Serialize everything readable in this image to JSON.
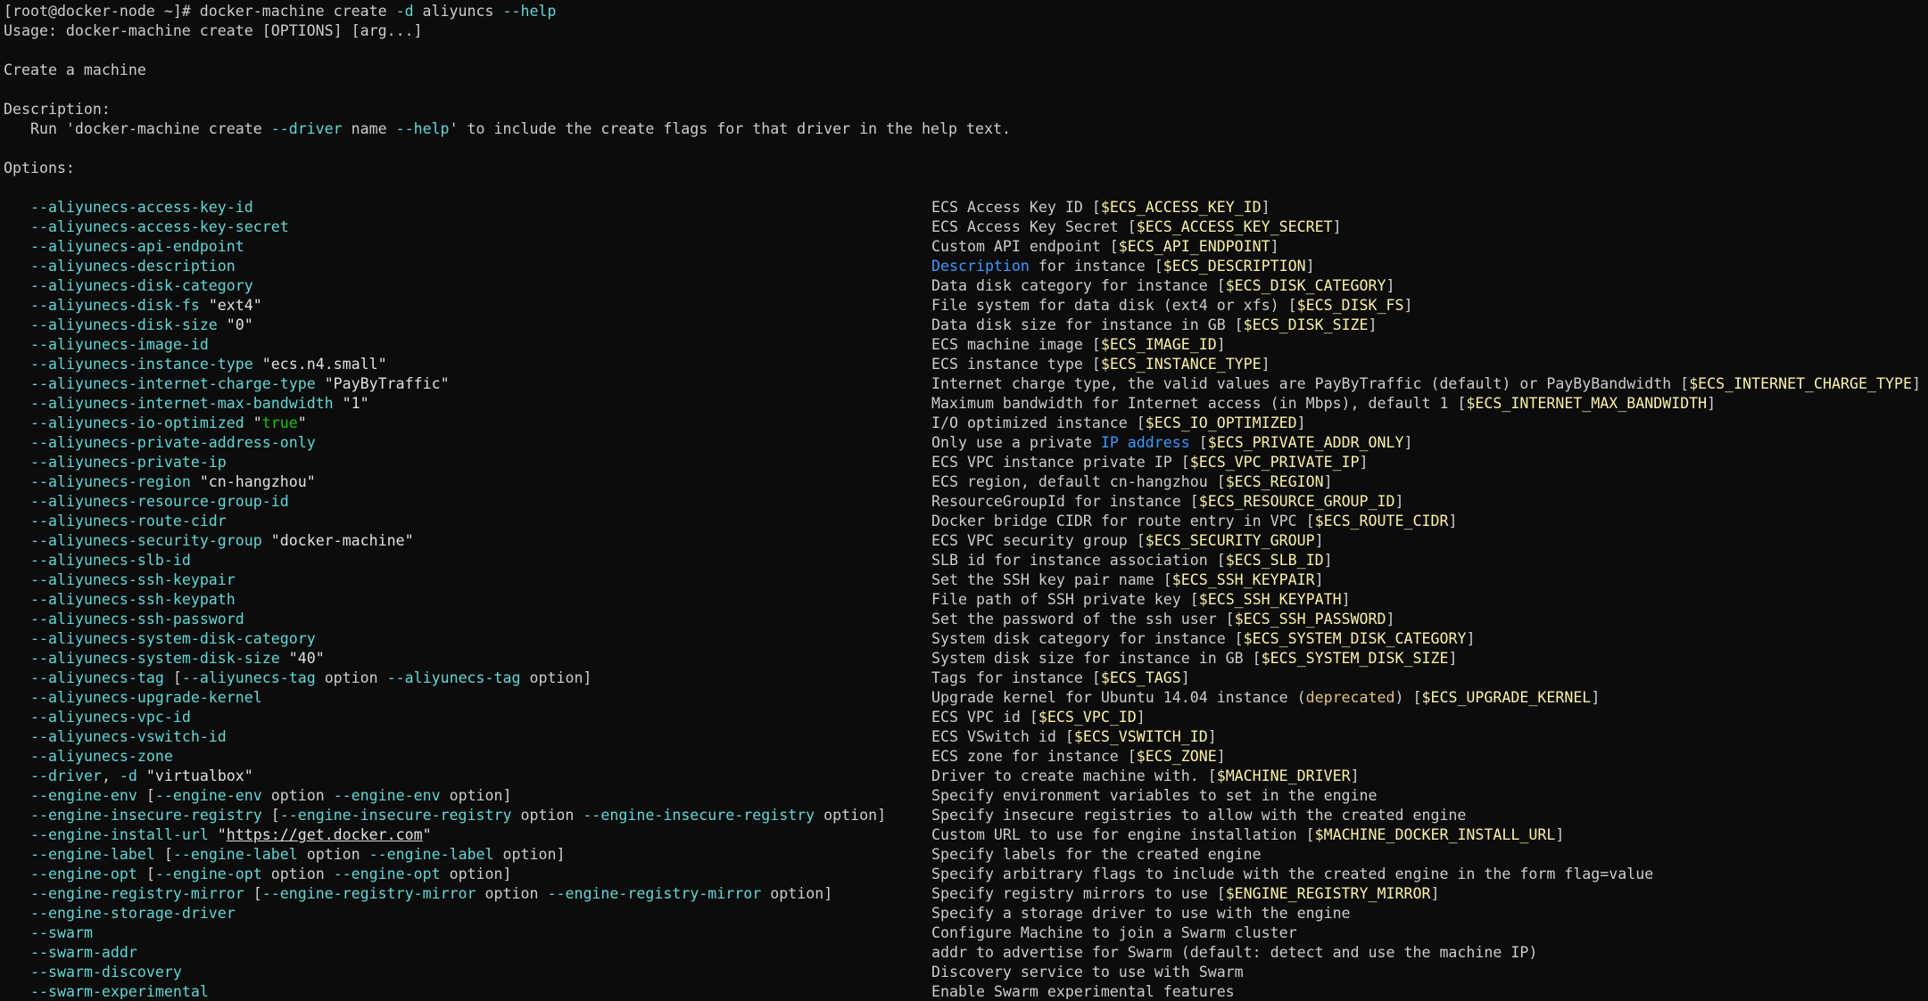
{
  "theme": {
    "background": "#0c0c0c",
    "foreground": "#cccccc",
    "flag": "#61d6d6",
    "string": "#e0e0e0",
    "env": "#f9f1a5",
    "link": "#3b9aff",
    "true": "#16c60c"
  },
  "header": [
    [
      {
        "t": "[root@docker-node ~]# docker-machine create ",
        "c": "plain"
      },
      {
        "t": "-d",
        "c": "flag"
      },
      {
        "t": " aliyuncs ",
        "c": "plain"
      },
      {
        "t": "--help",
        "c": "flag"
      }
    ],
    [
      {
        "t": "Usage: docker-machine create [OPTIONS] [arg...]",
        "c": "plain"
      }
    ],
    [],
    [
      {
        "t": "Create a machine",
        "c": "plain"
      }
    ],
    [],
    [
      {
        "t": "Description:",
        "c": "plain"
      }
    ],
    [
      {
        "t": "   Run 'docker-machine create ",
        "c": "plain"
      },
      {
        "t": "--driver",
        "c": "flag"
      },
      {
        "t": " name ",
        "c": "plain"
      },
      {
        "t": "--help",
        "c": "flag"
      },
      {
        "t": "' to include the create flags for that driver in the help text.",
        "c": "plain"
      }
    ],
    [],
    [
      {
        "t": "Options:",
        "c": "plain"
      }
    ],
    []
  ],
  "options": [
    {
      "left": [
        {
          "t": "--aliyunecs-access-key-id",
          "c": "flag"
        }
      ],
      "right": [
        {
          "t": "ECS Access Key ID [",
          "c": "plain"
        },
        {
          "t": "$ECS_ACCESS_KEY_ID",
          "c": "env"
        },
        {
          "t": "]",
          "c": "plain"
        }
      ]
    },
    {
      "left": [
        {
          "t": "--aliyunecs-access-key-secret",
          "c": "flag"
        }
      ],
      "right": [
        {
          "t": "ECS Access Key Secret [",
          "c": "plain"
        },
        {
          "t": "$ECS_ACCESS_KEY_SECRET",
          "c": "env"
        },
        {
          "t": "]",
          "c": "plain"
        }
      ]
    },
    {
      "left": [
        {
          "t": "--aliyunecs-api-endpoint",
          "c": "flag"
        }
      ],
      "right": [
        {
          "t": "Custom API endpoint [",
          "c": "plain"
        },
        {
          "t": "$ECS_API_ENDPOINT",
          "c": "env"
        },
        {
          "t": "]",
          "c": "plain"
        }
      ]
    },
    {
      "left": [
        {
          "t": "--aliyunecs-description",
          "c": "flag"
        }
      ],
      "right": [
        {
          "t": "Description",
          "c": "blue"
        },
        {
          "t": " for instance [",
          "c": "plain"
        },
        {
          "t": "$ECS_DESCRIPTION",
          "c": "env"
        },
        {
          "t": "]",
          "c": "plain"
        }
      ]
    },
    {
      "left": [
        {
          "t": "--aliyunecs-disk-category",
          "c": "flag"
        }
      ],
      "right": [
        {
          "t": "Data disk category for instance [",
          "c": "plain"
        },
        {
          "t": "$ECS_DISK_CATEGORY",
          "c": "env"
        },
        {
          "t": "]",
          "c": "plain"
        }
      ]
    },
    {
      "left": [
        {
          "t": "--aliyunecs-disk-fs",
          "c": "flag"
        },
        {
          "t": " \"ext4\"",
          "c": "string"
        }
      ],
      "right": [
        {
          "t": "File system for data disk (ext4 or xfs) [",
          "c": "plain"
        },
        {
          "t": "$ECS_DISK_FS",
          "c": "env"
        },
        {
          "t": "]",
          "c": "plain"
        }
      ]
    },
    {
      "left": [
        {
          "t": "--aliyunecs-disk-size",
          "c": "flag"
        },
        {
          "t": " \"0\"",
          "c": "string"
        }
      ],
      "right": [
        {
          "t": "Data disk size for instance in GB [",
          "c": "plain"
        },
        {
          "t": "$ECS_DISK_SIZE",
          "c": "env"
        },
        {
          "t": "]",
          "c": "plain"
        }
      ]
    },
    {
      "left": [
        {
          "t": "--aliyunecs-image-id",
          "c": "flag"
        }
      ],
      "right": [
        {
          "t": "ECS machine image [",
          "c": "plain"
        },
        {
          "t": "$ECS_IMAGE_ID",
          "c": "env"
        },
        {
          "t": "]",
          "c": "plain"
        }
      ]
    },
    {
      "left": [
        {
          "t": "--aliyunecs-instance-type",
          "c": "flag"
        },
        {
          "t": " \"ecs.n4.small\"",
          "c": "string"
        }
      ],
      "right": [
        {
          "t": "ECS instance type [",
          "c": "plain"
        },
        {
          "t": "$ECS_INSTANCE_TYPE",
          "c": "env"
        },
        {
          "t": "]",
          "c": "plain"
        }
      ]
    },
    {
      "left": [
        {
          "t": "--aliyunecs-internet-charge-type",
          "c": "flag"
        },
        {
          "t": " \"PayByTraffic\"",
          "c": "string"
        }
      ],
      "right": [
        {
          "t": "Internet charge type, the valid values are PayByTraffic (default) or PayByBandwidth [",
          "c": "plain"
        },
        {
          "t": "$ECS_INTERNET_CHARGE_TYPE",
          "c": "env"
        },
        {
          "t": "]",
          "c": "plain"
        }
      ]
    },
    {
      "left": [
        {
          "t": "--aliyunecs-internet-max-bandwidth",
          "c": "flag"
        },
        {
          "t": " \"1\"",
          "c": "string"
        }
      ],
      "right": [
        {
          "t": "Maximum bandwidth for Internet access (in Mbps), default 1 [",
          "c": "plain"
        },
        {
          "t": "$ECS_INTERNET_MAX_BANDWIDTH",
          "c": "env"
        },
        {
          "t": "]",
          "c": "plain"
        }
      ]
    },
    {
      "left": [
        {
          "t": "--aliyunecs-io-optimized",
          "c": "flag"
        },
        {
          "t": " \"",
          "c": "string"
        },
        {
          "t": "true",
          "c": "true"
        },
        {
          "t": "\"",
          "c": "string"
        }
      ],
      "right": [
        {
          "t": "I/O optimized instance [",
          "c": "plain"
        },
        {
          "t": "$ECS_IO_OPTIMIZED",
          "c": "env"
        },
        {
          "t": "]",
          "c": "plain"
        }
      ]
    },
    {
      "left": [
        {
          "t": "--aliyunecs-private-address-only",
          "c": "flag"
        }
      ],
      "right": [
        {
          "t": "Only use a private ",
          "c": "plain"
        },
        {
          "t": "IP address",
          "c": "blue"
        },
        {
          "t": " [",
          "c": "plain"
        },
        {
          "t": "$ECS_PRIVATE_ADDR_ONLY",
          "c": "env"
        },
        {
          "t": "]",
          "c": "plain"
        }
      ]
    },
    {
      "left": [
        {
          "t": "--aliyunecs-private-ip",
          "c": "flag"
        }
      ],
      "right": [
        {
          "t": "ECS VPC instance private IP [",
          "c": "plain"
        },
        {
          "t": "$ECS_VPC_PRIVATE_IP",
          "c": "env"
        },
        {
          "t": "]",
          "c": "plain"
        }
      ]
    },
    {
      "left": [
        {
          "t": "--aliyunecs-region",
          "c": "flag"
        },
        {
          "t": " \"cn-hangzhou\"",
          "c": "string"
        }
      ],
      "right": [
        {
          "t": "ECS region, default cn-hangzhou [",
          "c": "plain"
        },
        {
          "t": "$ECS_REGION",
          "c": "env"
        },
        {
          "t": "]",
          "c": "plain"
        }
      ]
    },
    {
      "left": [
        {
          "t": "--aliyunecs-resource-group-id",
          "c": "flag"
        }
      ],
      "right": [
        {
          "t": "ResourceGroupId for instance [",
          "c": "plain"
        },
        {
          "t": "$ECS_RESOURCE_GROUP_ID",
          "c": "env"
        },
        {
          "t": "]",
          "c": "plain"
        }
      ]
    },
    {
      "left": [
        {
          "t": "--aliyunecs-route-cidr",
          "c": "flag"
        }
      ],
      "right": [
        {
          "t": "Docker bridge CIDR for route entry in VPC [",
          "c": "plain"
        },
        {
          "t": "$ECS_ROUTE_CIDR",
          "c": "env"
        },
        {
          "t": "]",
          "c": "plain"
        }
      ]
    },
    {
      "left": [
        {
          "t": "--aliyunecs-security-group",
          "c": "flag"
        },
        {
          "t": " \"docker-machine\"",
          "c": "string"
        }
      ],
      "right": [
        {
          "t": "ECS VPC security group [",
          "c": "plain"
        },
        {
          "t": "$ECS_SECURITY_GROUP",
          "c": "env"
        },
        {
          "t": "]",
          "c": "plain"
        }
      ]
    },
    {
      "left": [
        {
          "t": "--aliyunecs-slb-id",
          "c": "flag"
        }
      ],
      "right": [
        {
          "t": "SLB id for instance association [",
          "c": "plain"
        },
        {
          "t": "$ECS_SLB_ID",
          "c": "env"
        },
        {
          "t": "]",
          "c": "plain"
        }
      ]
    },
    {
      "left": [
        {
          "t": "--aliyunecs-ssh-keypair",
          "c": "flag"
        }
      ],
      "right": [
        {
          "t": "Set the SSH key pair name [",
          "c": "plain"
        },
        {
          "t": "$ECS_SSH_KEYPAIR",
          "c": "env"
        },
        {
          "t": "]",
          "c": "plain"
        }
      ]
    },
    {
      "left": [
        {
          "t": "--aliyunecs-ssh-keypath",
          "c": "flag"
        }
      ],
      "right": [
        {
          "t": "File path of SSH private key [",
          "c": "plain"
        },
        {
          "t": "$ECS_SSH_KEYPATH",
          "c": "env"
        },
        {
          "t": "]",
          "c": "plain"
        }
      ]
    },
    {
      "left": [
        {
          "t": "--aliyunecs-ssh-password",
          "c": "flag"
        }
      ],
      "right": [
        {
          "t": "Set the password of the ssh user [",
          "c": "plain"
        },
        {
          "t": "$ECS_SSH_PASSWORD",
          "c": "env"
        },
        {
          "t": "]",
          "c": "plain"
        }
      ]
    },
    {
      "left": [
        {
          "t": "--aliyunecs-system-disk-category",
          "c": "flag"
        }
      ],
      "right": [
        {
          "t": "System disk category for instance [",
          "c": "plain"
        },
        {
          "t": "$ECS_SYSTEM_DISK_CATEGORY",
          "c": "env"
        },
        {
          "t": "]",
          "c": "plain"
        }
      ]
    },
    {
      "left": [
        {
          "t": "--aliyunecs-system-disk-size",
          "c": "flag"
        },
        {
          "t": " \"40\"",
          "c": "string"
        }
      ],
      "right": [
        {
          "t": "System disk size for instance in GB [",
          "c": "plain"
        },
        {
          "t": "$ECS_SYSTEM_DISK_SIZE",
          "c": "env"
        },
        {
          "t": "]",
          "c": "plain"
        }
      ]
    },
    {
      "left": [
        {
          "t": "--aliyunecs-tag",
          "c": "flag"
        },
        {
          "t": " [",
          "c": "plain"
        },
        {
          "t": "--aliyunecs-tag",
          "c": "flag"
        },
        {
          "t": " option ",
          "c": "plain"
        },
        {
          "t": "--aliyunecs-tag",
          "c": "flag"
        },
        {
          "t": " option]",
          "c": "plain"
        }
      ],
      "right": [
        {
          "t": "Tags for instance [",
          "c": "plain"
        },
        {
          "t": "$ECS_TAGS",
          "c": "env"
        },
        {
          "t": "]",
          "c": "plain"
        }
      ]
    },
    {
      "left": [
        {
          "t": "--aliyunecs-upgrade-kernel",
          "c": "flag"
        }
      ],
      "right": [
        {
          "t": "Upgrade kernel for Ubuntu 14.04 instance (",
          "c": "plain"
        },
        {
          "t": "deprecated",
          "c": "kw"
        },
        {
          "t": ") [",
          "c": "plain"
        },
        {
          "t": "$ECS_UPGRADE_KERNEL",
          "c": "env"
        },
        {
          "t": "]",
          "c": "plain"
        }
      ]
    },
    {
      "left": [
        {
          "t": "--aliyunecs-vpc-id",
          "c": "flag"
        }
      ],
      "right": [
        {
          "t": "ECS VPC id [",
          "c": "plain"
        },
        {
          "t": "$ECS_VPC_ID",
          "c": "env"
        },
        {
          "t": "]",
          "c": "plain"
        }
      ]
    },
    {
      "left": [
        {
          "t": "--aliyunecs-vswitch-id",
          "c": "flag"
        }
      ],
      "right": [
        {
          "t": "ECS VSwitch id [",
          "c": "plain"
        },
        {
          "t": "$ECS_VSWITCH_ID",
          "c": "env"
        },
        {
          "t": "]",
          "c": "plain"
        }
      ]
    },
    {
      "left": [
        {
          "t": "--aliyunecs-zone",
          "c": "flag"
        }
      ],
      "right": [
        {
          "t": "ECS zone for instance [",
          "c": "plain"
        },
        {
          "t": "$ECS_ZONE",
          "c": "env"
        },
        {
          "t": "]",
          "c": "plain"
        }
      ]
    },
    {
      "left": [
        {
          "t": "--driver",
          "c": "flag"
        },
        {
          "t": ", ",
          "c": "plain"
        },
        {
          "t": "-d",
          "c": "flag"
        },
        {
          "t": " \"virtualbox\"",
          "c": "string"
        }
      ],
      "right": [
        {
          "t": "Driver to create machine with. [",
          "c": "plain"
        },
        {
          "t": "$MACHINE_DRIVER",
          "c": "env"
        },
        {
          "t": "]",
          "c": "plain"
        }
      ]
    },
    {
      "left": [
        {
          "t": "--engine-env",
          "c": "flag"
        },
        {
          "t": " [",
          "c": "plain"
        },
        {
          "t": "--engine-env",
          "c": "flag"
        },
        {
          "t": " option ",
          "c": "plain"
        },
        {
          "t": "--engine-env",
          "c": "flag"
        },
        {
          "t": " option]",
          "c": "plain"
        }
      ],
      "right": [
        {
          "t": "Specify environment variables to set in the engine",
          "c": "plain"
        }
      ]
    },
    {
      "left": [
        {
          "t": "--engine-insecure-registry",
          "c": "flag"
        },
        {
          "t": " [",
          "c": "plain"
        },
        {
          "t": "--engine-insecure-registry",
          "c": "flag"
        },
        {
          "t": " option ",
          "c": "plain"
        },
        {
          "t": "--engine-insecure-registry",
          "c": "flag"
        },
        {
          "t": " option]",
          "c": "plain"
        }
      ],
      "right": [
        {
          "t": "Specify insecure registries to allow with the created engine",
          "c": "plain"
        }
      ]
    },
    {
      "left": [
        {
          "t": "--engine-install-url",
          "c": "flag"
        },
        {
          "t": " \"",
          "c": "string"
        },
        {
          "t": "https://get.docker.com",
          "c": "url"
        },
        {
          "t": "\"",
          "c": "string"
        }
      ],
      "right": [
        {
          "t": "Custom URL to use for engine installation [",
          "c": "plain"
        },
        {
          "t": "$MACHINE_DOCKER_INSTALL_URL",
          "c": "env"
        },
        {
          "t": "]",
          "c": "plain"
        }
      ]
    },
    {
      "left": [
        {
          "t": "--engine-label",
          "c": "flag"
        },
        {
          "t": " [",
          "c": "plain"
        },
        {
          "t": "--engine-label",
          "c": "flag"
        },
        {
          "t": " option ",
          "c": "plain"
        },
        {
          "t": "--engine-label",
          "c": "flag"
        },
        {
          "t": " option]",
          "c": "plain"
        }
      ],
      "right": [
        {
          "t": "Specify labels for the created engine",
          "c": "plain"
        }
      ]
    },
    {
      "left": [
        {
          "t": "--engine-opt",
          "c": "flag"
        },
        {
          "t": " [",
          "c": "plain"
        },
        {
          "t": "--engine-opt",
          "c": "flag"
        },
        {
          "t": " option ",
          "c": "plain"
        },
        {
          "t": "--engine-opt",
          "c": "flag"
        },
        {
          "t": " option]",
          "c": "plain"
        }
      ],
      "right": [
        {
          "t": "Specify arbitrary flags to include with the created engine in the form flag=value",
          "c": "plain"
        }
      ]
    },
    {
      "left": [
        {
          "t": "--engine-registry-mirror",
          "c": "flag"
        },
        {
          "t": " [",
          "c": "plain"
        },
        {
          "t": "--engine-registry-mirror",
          "c": "flag"
        },
        {
          "t": " option ",
          "c": "plain"
        },
        {
          "t": "--engine-registry-mirror",
          "c": "flag"
        },
        {
          "t": " option]",
          "c": "plain"
        }
      ],
      "right": [
        {
          "t": "Specify registry mirrors to use [",
          "c": "plain"
        },
        {
          "t": "$ENGINE_REGISTRY_MIRROR",
          "c": "env"
        },
        {
          "t": "]",
          "c": "plain"
        }
      ]
    },
    {
      "left": [
        {
          "t": "--engine-storage-driver",
          "c": "flag"
        }
      ],
      "right": [
        {
          "t": "Specify a storage driver to use with the engine",
          "c": "plain"
        }
      ]
    },
    {
      "left": [
        {
          "t": "--swarm",
          "c": "flag"
        }
      ],
      "right": [
        {
          "t": "Configure Machine to join a Swarm cluster",
          "c": "plain"
        }
      ]
    },
    {
      "left": [
        {
          "t": "--swarm-addr",
          "c": "flag"
        }
      ],
      "right": [
        {
          "t": "addr to advertise for Swarm (default: detect and use the machine IP)",
          "c": "plain"
        }
      ]
    },
    {
      "left": [
        {
          "t": "--swarm-discovery",
          "c": "flag"
        }
      ],
      "right": [
        {
          "t": "Discovery service to use with Swarm",
          "c": "plain"
        }
      ]
    },
    {
      "left": [
        {
          "t": "--swarm-experimental",
          "c": "flag"
        }
      ],
      "right": [
        {
          "t": "Enable Swarm experimental features",
          "c": "plain"
        }
      ]
    }
  ]
}
